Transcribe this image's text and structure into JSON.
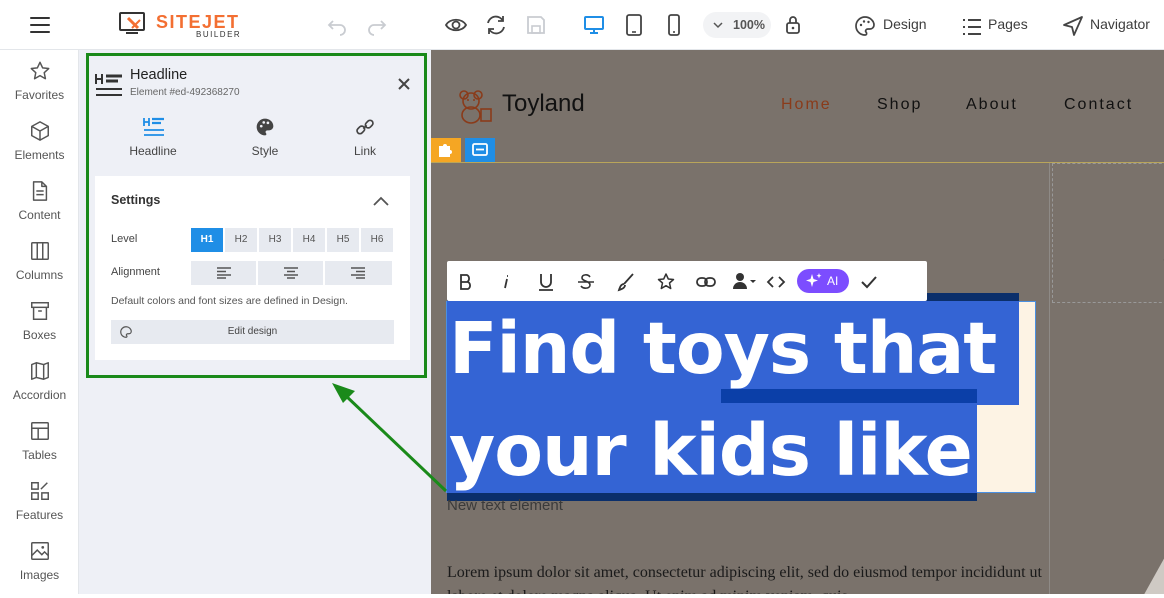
{
  "app": {
    "logo_name": "SITEJET",
    "logo_sub": "BUILDER"
  },
  "topbar": {
    "zoom": "100%",
    "design_label": "Design",
    "pages_label": "Pages",
    "navigator_label": "Navigator"
  },
  "sidebar": {
    "items": [
      {
        "label": "Favorites",
        "icon": "star-icon"
      },
      {
        "label": "Elements",
        "icon": "cube-icon"
      },
      {
        "label": "Content",
        "icon": "document-icon"
      },
      {
        "label": "Columns",
        "icon": "columns-icon"
      },
      {
        "label": "Boxes",
        "icon": "box-icon"
      },
      {
        "label": "Accordion",
        "icon": "accordion-icon"
      },
      {
        "label": "Tables",
        "icon": "table-icon"
      },
      {
        "label": "Features",
        "icon": "features-icon"
      },
      {
        "label": "Images",
        "icon": "image-icon"
      }
    ]
  },
  "panel": {
    "title": "Headline",
    "element_id": "Element #ed-492368270",
    "tabs": [
      {
        "label": "Headline",
        "icon": "headline-icon"
      },
      {
        "label": "Style",
        "icon": "palette-icon"
      },
      {
        "label": "Link",
        "icon": "link-icon"
      }
    ],
    "settings": {
      "title": "Settings",
      "level_label": "Level",
      "levels": [
        "H1",
        "H2",
        "H3",
        "H4",
        "H5",
        "H6"
      ],
      "active_level": "H1",
      "alignment_label": "Alignment",
      "note": "Default colors and font sizes are defined in Design.",
      "edit_design_label": "Edit design"
    }
  },
  "site": {
    "brand": "Toyland",
    "nav": [
      "Home",
      "Shop",
      "About",
      "Contact"
    ],
    "active_nav": "Home",
    "headline_line1": "Find toys that",
    "headline_line2": "your kids like",
    "new_text": "New text element",
    "lorem": "Lorem ipsum dolor sit amet, consectetur adipiscing elit, sed do eiusmod tempor incididunt ut labore et dolore magna aliqua. Ut enim ad minim veniam, quis"
  },
  "toolbar": {
    "ai_label": "AI"
  },
  "colors": {
    "accent": "#1f8ee6",
    "brand_orange": "#f36f32",
    "highlight_green": "#1a8a1a",
    "selection_blue": "#3464d4",
    "ai_purple": "#7c4dff"
  }
}
